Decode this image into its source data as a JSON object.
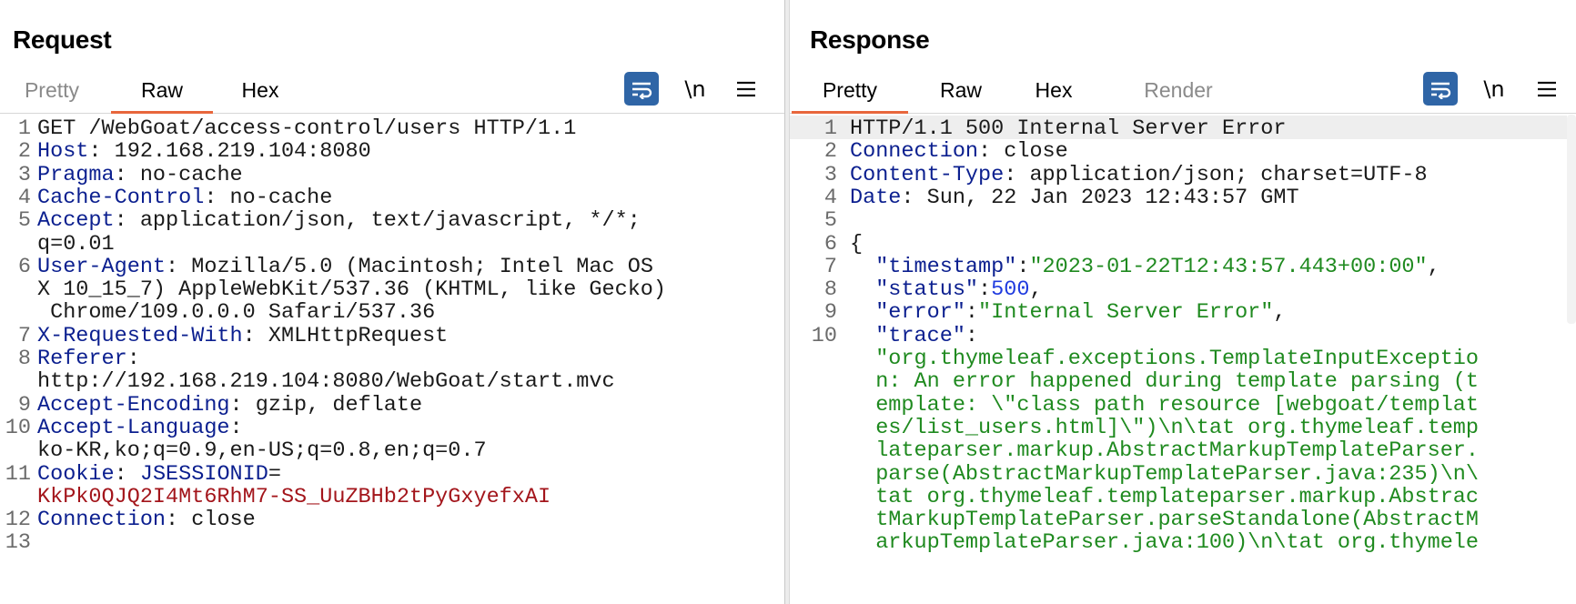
{
  "request": {
    "title": "Request",
    "tabs": [
      "Pretty",
      "Raw",
      "Hex"
    ],
    "active_tab": "Raw",
    "newline_toggle": "\\n",
    "lines": [
      {
        "n": "1",
        "parts": [
          "GET /WebGoat/access-control/users HTTP/1.1"
        ]
      },
      {
        "n": "2",
        "parts": [
          "Host",
          ": 192.168.219.104:8080"
        ]
      },
      {
        "n": "3",
        "parts": [
          "Pragma",
          ": no-cache"
        ]
      },
      {
        "n": "4",
        "parts": [
          "Cache-Control",
          ": no-cache"
        ]
      },
      {
        "n": "5",
        "parts": [
          "Accept",
          ": application/json, text/javascript, */*;"
        ]
      },
      {
        "n": "",
        "parts": [
          "q=0.01"
        ]
      },
      {
        "n": "6",
        "parts": [
          "User-Agent",
          ": Mozilla/5.0 (Macintosh; Intel Mac OS"
        ]
      },
      {
        "n": "",
        "parts": [
          "X 10_15_7) AppleWebKit/537.36 (KHTML, like Gecko)"
        ]
      },
      {
        "n": "",
        "parts": [
          " Chrome/109.0.0.0 Safari/537.36"
        ]
      },
      {
        "n": "7",
        "parts": [
          "X-Requested-With",
          ": XMLHttpRequest"
        ]
      },
      {
        "n": "8",
        "parts": [
          "Referer",
          ":"
        ]
      },
      {
        "n": "",
        "parts": [
          "http://192.168.219.104:8080/WebGoat/start.mvc"
        ]
      },
      {
        "n": "9",
        "parts": [
          "Accept-Encoding",
          ": gzip, deflate"
        ]
      },
      {
        "n": "10",
        "parts": [
          "Accept-Language",
          ":"
        ]
      },
      {
        "n": "",
        "parts": [
          "ko-KR,ko;q=0.9,en-US;q=0.8,en;q=0.7"
        ]
      },
      {
        "n": "11",
        "parts": [
          "Cookie",
          ": ",
          "JSESSIONID",
          "="
        ]
      },
      {
        "n": "",
        "parts": [
          "KkPk0QJQ2I4Mt6RhM7-SS_UuZBHb2tPyGxyefxAI"
        ]
      },
      {
        "n": "12",
        "parts": [
          "Connection",
          ": close"
        ]
      },
      {
        "n": "13",
        "parts": [
          ""
        ]
      }
    ]
  },
  "response": {
    "title": "Response",
    "tabs": [
      "Pretty",
      "Raw",
      "Hex",
      "Render"
    ],
    "active_tab": "Pretty",
    "newline_toggle": "\\n",
    "lines": [
      {
        "n": "1",
        "parts": [
          "HTTP/1.1 500 Internal Server Error"
        ]
      },
      {
        "n": "2",
        "parts": [
          "Connection",
          ": close"
        ]
      },
      {
        "n": "3",
        "parts": [
          "Content-Type",
          ": application/json; charset=UTF-8"
        ]
      },
      {
        "n": "4",
        "parts": [
          "Date",
          ": Sun, 22 Jan 2023 12:43:57 GMT"
        ]
      },
      {
        "n": "5",
        "parts": [
          ""
        ]
      },
      {
        "n": "6",
        "parts": [
          "{"
        ]
      },
      {
        "n": "7",
        "parts": [
          "  \"timestamp\"",
          ":",
          "\"2023-01-22T12:43:57.443+00:00\"",
          ","
        ]
      },
      {
        "n": "8",
        "parts": [
          "  \"status\"",
          ":",
          "500",
          ","
        ]
      },
      {
        "n": "9",
        "parts": [
          "  \"error\"",
          ":",
          "\"Internal Server Error\"",
          ","
        ]
      },
      {
        "n": "10",
        "parts": [
          "  \"trace\"",
          ":"
        ]
      },
      {
        "n": "",
        "parts": [
          "  \"org.thymeleaf.exceptions.TemplateInputExceptio"
        ]
      },
      {
        "n": "",
        "parts": [
          "  n: An error happened during template parsing (t"
        ]
      },
      {
        "n": "",
        "parts": [
          "  emplate: \\\"class path resource [webgoat/templat"
        ]
      },
      {
        "n": "",
        "parts": [
          "  es/list_users.html]\\\")\\n\\tat org.thymeleaf.temp"
        ]
      },
      {
        "n": "",
        "parts": [
          "  lateparser.markup.AbstractMarkupTemplateParser."
        ]
      },
      {
        "n": "",
        "parts": [
          "  parse(AbstractMarkupTemplateParser.java:235)\\n\\"
        ]
      },
      {
        "n": "",
        "parts": [
          "  tat org.thymeleaf.templateparser.markup.Abstrac"
        ]
      },
      {
        "n": "",
        "parts": [
          "  tMarkupTemplateParser.parseStandalone(AbstractM"
        ]
      },
      {
        "n": "",
        "parts": [
          "  arkupTemplateParser.java:100)\\n\\tat org.thymele"
        ]
      }
    ]
  },
  "colors": {
    "accent_tab_underline": "#e8663c",
    "button_blue": "#2f65a6",
    "header_name": "#0b1f8f",
    "cookie_value": "#a3151b",
    "json_string": "#1f8a1f",
    "json_number": "#1e3adf"
  },
  "icons": {
    "wrap_toggle": "wrap-lines-icon",
    "menu": "hamburger-menu-icon",
    "layout_side_by_side": "split-columns-icon",
    "layout_stacked": "split-rows-icon",
    "layout_single": "single-pane-icon"
  }
}
